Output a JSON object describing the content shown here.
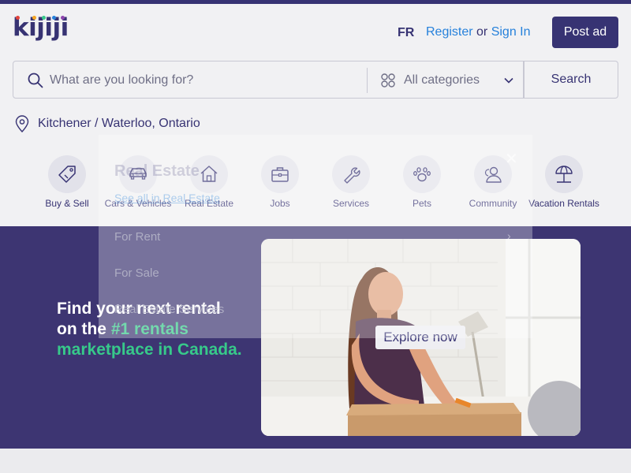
{
  "logo": {
    "text": "kijiji",
    "dot_colors": [
      "#e4443b",
      "#f5a623",
      "#37c98a",
      "#2681db",
      "#8e44ad"
    ]
  },
  "header": {
    "lang_label": "FR",
    "register_label": "Register",
    "or_label": " or ",
    "signin_label": "Sign In",
    "post_ad_label": "Post ad"
  },
  "search": {
    "placeholder": "What are you looking for?",
    "category_label": "All categories",
    "button_label": "Search"
  },
  "location": {
    "label": "Kitchener / Waterloo, Ontario"
  },
  "categories": [
    {
      "label": "Buy & Sell",
      "icon": "tag-icon"
    },
    {
      "label": "Cars & Vehicles",
      "icon": "car-icon"
    },
    {
      "label": "Real Estate",
      "icon": "house-icon"
    },
    {
      "label": "Jobs",
      "icon": "briefcase-icon"
    },
    {
      "label": "Services",
      "icon": "wrench-icon"
    },
    {
      "label": "Pets",
      "icon": "paw-icon"
    },
    {
      "label": "Community",
      "icon": "people-icon"
    },
    {
      "label": "Vacation Rentals",
      "icon": "beach-umbrella-icon"
    }
  ],
  "overlay": {
    "title": "Real Estate",
    "link": "See all in Real Estate",
    "items": [
      "For Rent",
      "For Sale",
      "Real Estate Services"
    ]
  },
  "hero": {
    "line1": "Find your next rental",
    "line2_prefix": "on the ",
    "accent": "#1 rentals marketplace in Canada.",
    "cta": "Explore now"
  },
  "colors": {
    "brand": "#373373",
    "link": "#2681db",
    "hero_bg": "#3d3572",
    "accent_green": "#37c98a"
  }
}
